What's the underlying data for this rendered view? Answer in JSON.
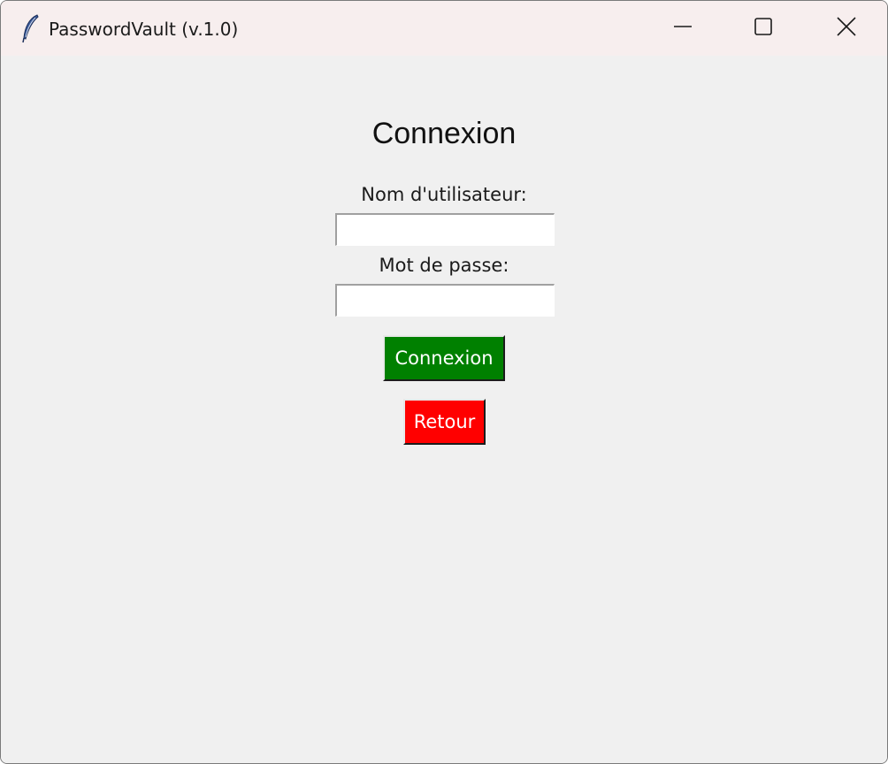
{
  "window": {
    "title": "PasswordVault (v.1.0)",
    "app_icon": "feather-icon",
    "controls": {
      "minimize_icon": "minimize-icon",
      "maximize_icon": "maximize-icon",
      "close_icon": "close-icon"
    }
  },
  "login": {
    "heading": "Connexion",
    "username_label": "Nom d'utilisateur:",
    "username_value": "",
    "password_label": "Mot de passe:",
    "password_value": "",
    "login_button": "Connexion",
    "back_button": "Retour"
  },
  "colors": {
    "login_button_bg": "#008000",
    "back_button_bg": "#ff0000",
    "window_bg": "#f0f0f0",
    "titlebar_bg": "#f7eeee"
  }
}
